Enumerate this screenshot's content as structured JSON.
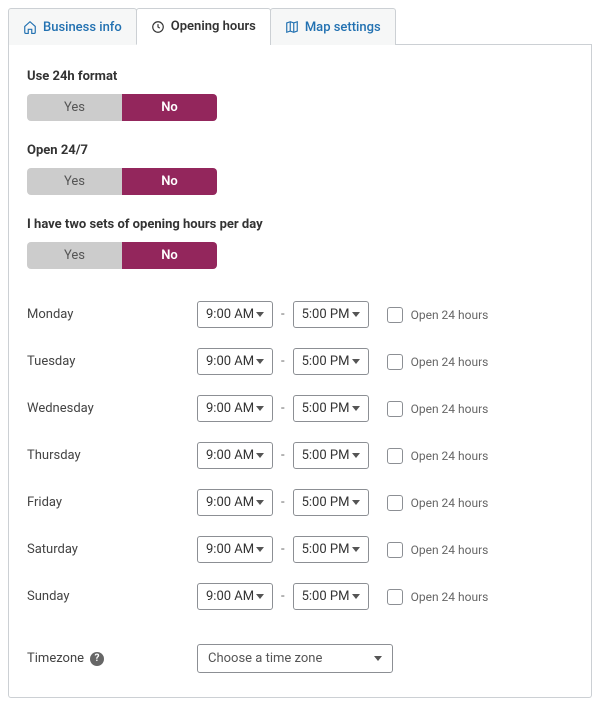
{
  "tabs": {
    "business_info": "Business info",
    "opening_hours": "Opening hours",
    "map_settings": "Map settings"
  },
  "settings": {
    "use_24h": {
      "title": "Use 24h format",
      "yes": "Yes",
      "no": "No"
    },
    "open_247": {
      "title": "Open 24/7",
      "yes": "Yes",
      "no": "No"
    },
    "two_sets": {
      "title": "I have two sets of opening hours per day",
      "yes": "Yes",
      "no": "No"
    }
  },
  "days": [
    {
      "name": "Monday",
      "open": "9:00 AM",
      "close": "5:00 PM"
    },
    {
      "name": "Tuesday",
      "open": "9:00 AM",
      "close": "5:00 PM"
    },
    {
      "name": "Wednesday",
      "open": "9:00 AM",
      "close": "5:00 PM"
    },
    {
      "name": "Thursday",
      "open": "9:00 AM",
      "close": "5:00 PM"
    },
    {
      "name": "Friday",
      "open": "9:00 AM",
      "close": "5:00 PM"
    },
    {
      "name": "Saturday",
      "open": "9:00 AM",
      "close": "5:00 PM"
    },
    {
      "name": "Sunday",
      "open": "9:00 AM",
      "close": "5:00 PM"
    }
  ],
  "open_24_label": "Open 24 hours",
  "timezone": {
    "label": "Timezone",
    "placeholder": "Choose a time zone"
  }
}
